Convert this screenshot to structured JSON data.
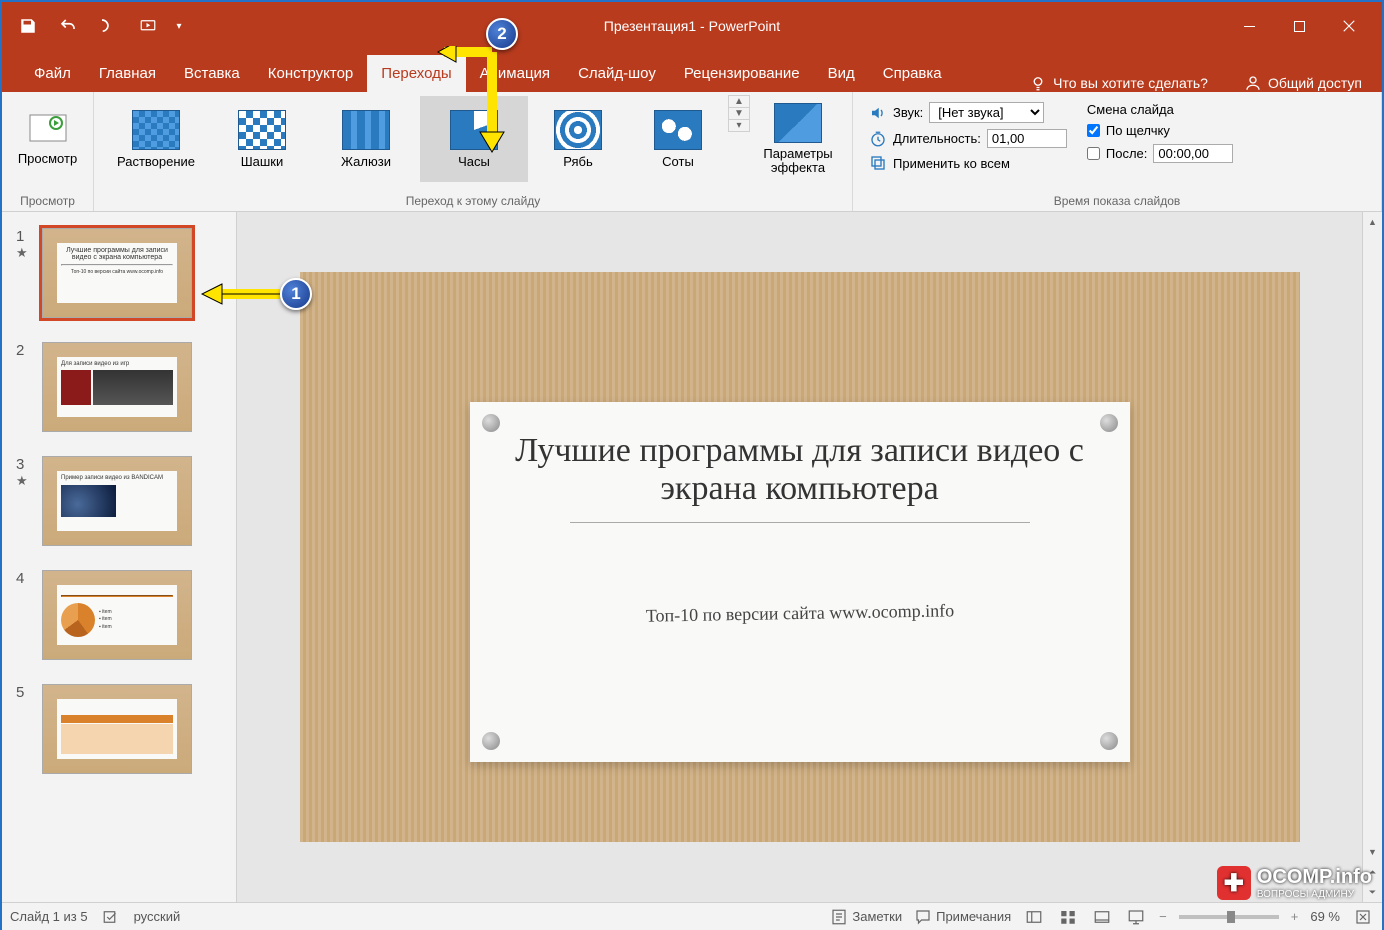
{
  "title": "Презентация1 - PowerPoint",
  "tabs": [
    "Файл",
    "Главная",
    "Вставка",
    "Конструктор",
    "Переходы",
    "Анимация",
    "Слайд-шоу",
    "Рецензирование",
    "Вид",
    "Справка"
  ],
  "active_tab": 4,
  "tell_me": "Что вы хотите сделать?",
  "share": "Общий доступ",
  "ribbon": {
    "preview_group": "Просмотр",
    "preview_btn": "Просмотр",
    "transition_group": "Переход к этому слайду",
    "transitions": [
      "Растворение",
      "Шашки",
      "Жалюзи",
      "Часы",
      "Рябь",
      "Соты"
    ],
    "selected_transition": 3,
    "effect_options": "Параметры эффекта",
    "timing_group": "Время показа слайдов",
    "sound_label": "Звук:",
    "sound_value": "[Нет звука]",
    "duration_label": "Длительность:",
    "duration_value": "01,00",
    "apply_all": "Применить ко всем",
    "advance_label": "Смена слайда",
    "on_click": "По щелчку",
    "after_label": "После:",
    "after_value": "00:00,00"
  },
  "thumbnails": [
    {
      "num": "1",
      "star": true,
      "title": "Лучшие программы для записи видео с экрана компьютера",
      "sub": "Топ-10 по версии сайта www.ocomp.info"
    },
    {
      "num": "2",
      "star": false,
      "title": "Для записи видео из игр"
    },
    {
      "num": "3",
      "star": true,
      "title": "Пример записи видео из BANDICAM"
    },
    {
      "num": "4",
      "star": false,
      "title": ""
    },
    {
      "num": "5",
      "star": false,
      "title": ""
    }
  ],
  "slide": {
    "title": "Лучшие программы для записи видео с экрана компьютера",
    "subtitle": "Топ-10 по версии сайта www.ocomp.info"
  },
  "statusbar": {
    "slide_pos": "Слайд 1 из 5",
    "lang": "русский",
    "notes": "Заметки",
    "comments": "Примечания",
    "zoom": "69 %"
  },
  "callouts": {
    "c1": "1",
    "c2": "2"
  },
  "watermark": {
    "main": "OCOMP.info",
    "sub": "ВОПРОСЫ АДМИНУ"
  }
}
